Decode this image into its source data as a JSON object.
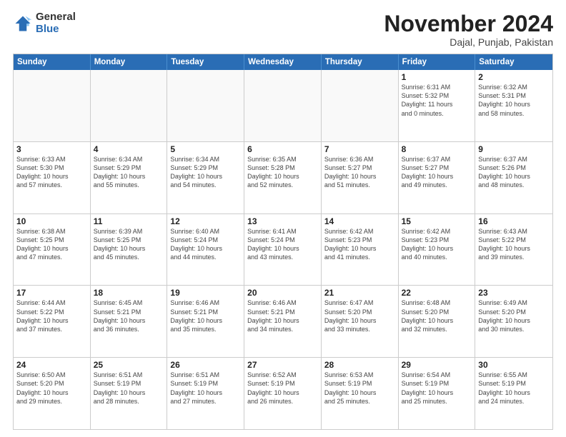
{
  "logo": {
    "general": "General",
    "blue": "Blue"
  },
  "title": "November 2024",
  "subtitle": "Dajal, Punjab, Pakistan",
  "header_days": [
    "Sunday",
    "Monday",
    "Tuesday",
    "Wednesday",
    "Thursday",
    "Friday",
    "Saturday"
  ],
  "weeks": [
    [
      {
        "day": "",
        "info": "",
        "shaded": true
      },
      {
        "day": "",
        "info": "",
        "shaded": true
      },
      {
        "day": "",
        "info": "",
        "shaded": true
      },
      {
        "day": "",
        "info": "",
        "shaded": true
      },
      {
        "day": "",
        "info": "",
        "shaded": true
      },
      {
        "day": "1",
        "info": "Sunrise: 6:31 AM\nSunset: 5:32 PM\nDaylight: 11 hours\nand 0 minutes."
      },
      {
        "day": "2",
        "info": "Sunrise: 6:32 AM\nSunset: 5:31 PM\nDaylight: 10 hours\nand 58 minutes."
      }
    ],
    [
      {
        "day": "3",
        "info": "Sunrise: 6:33 AM\nSunset: 5:30 PM\nDaylight: 10 hours\nand 57 minutes."
      },
      {
        "day": "4",
        "info": "Sunrise: 6:34 AM\nSunset: 5:29 PM\nDaylight: 10 hours\nand 55 minutes."
      },
      {
        "day": "5",
        "info": "Sunrise: 6:34 AM\nSunset: 5:29 PM\nDaylight: 10 hours\nand 54 minutes."
      },
      {
        "day": "6",
        "info": "Sunrise: 6:35 AM\nSunset: 5:28 PM\nDaylight: 10 hours\nand 52 minutes."
      },
      {
        "day": "7",
        "info": "Sunrise: 6:36 AM\nSunset: 5:27 PM\nDaylight: 10 hours\nand 51 minutes."
      },
      {
        "day": "8",
        "info": "Sunrise: 6:37 AM\nSunset: 5:27 PM\nDaylight: 10 hours\nand 49 minutes."
      },
      {
        "day": "9",
        "info": "Sunrise: 6:37 AM\nSunset: 5:26 PM\nDaylight: 10 hours\nand 48 minutes."
      }
    ],
    [
      {
        "day": "10",
        "info": "Sunrise: 6:38 AM\nSunset: 5:25 PM\nDaylight: 10 hours\nand 47 minutes."
      },
      {
        "day": "11",
        "info": "Sunrise: 6:39 AM\nSunset: 5:25 PM\nDaylight: 10 hours\nand 45 minutes."
      },
      {
        "day": "12",
        "info": "Sunrise: 6:40 AM\nSunset: 5:24 PM\nDaylight: 10 hours\nand 44 minutes."
      },
      {
        "day": "13",
        "info": "Sunrise: 6:41 AM\nSunset: 5:24 PM\nDaylight: 10 hours\nand 43 minutes."
      },
      {
        "day": "14",
        "info": "Sunrise: 6:42 AM\nSunset: 5:23 PM\nDaylight: 10 hours\nand 41 minutes."
      },
      {
        "day": "15",
        "info": "Sunrise: 6:42 AM\nSunset: 5:23 PM\nDaylight: 10 hours\nand 40 minutes."
      },
      {
        "day": "16",
        "info": "Sunrise: 6:43 AM\nSunset: 5:22 PM\nDaylight: 10 hours\nand 39 minutes."
      }
    ],
    [
      {
        "day": "17",
        "info": "Sunrise: 6:44 AM\nSunset: 5:22 PM\nDaylight: 10 hours\nand 37 minutes."
      },
      {
        "day": "18",
        "info": "Sunrise: 6:45 AM\nSunset: 5:21 PM\nDaylight: 10 hours\nand 36 minutes."
      },
      {
        "day": "19",
        "info": "Sunrise: 6:46 AM\nSunset: 5:21 PM\nDaylight: 10 hours\nand 35 minutes."
      },
      {
        "day": "20",
        "info": "Sunrise: 6:46 AM\nSunset: 5:21 PM\nDaylight: 10 hours\nand 34 minutes."
      },
      {
        "day": "21",
        "info": "Sunrise: 6:47 AM\nSunset: 5:20 PM\nDaylight: 10 hours\nand 33 minutes."
      },
      {
        "day": "22",
        "info": "Sunrise: 6:48 AM\nSunset: 5:20 PM\nDaylight: 10 hours\nand 32 minutes."
      },
      {
        "day": "23",
        "info": "Sunrise: 6:49 AM\nSunset: 5:20 PM\nDaylight: 10 hours\nand 30 minutes."
      }
    ],
    [
      {
        "day": "24",
        "info": "Sunrise: 6:50 AM\nSunset: 5:20 PM\nDaylight: 10 hours\nand 29 minutes."
      },
      {
        "day": "25",
        "info": "Sunrise: 6:51 AM\nSunset: 5:19 PM\nDaylight: 10 hours\nand 28 minutes."
      },
      {
        "day": "26",
        "info": "Sunrise: 6:51 AM\nSunset: 5:19 PM\nDaylight: 10 hours\nand 27 minutes."
      },
      {
        "day": "27",
        "info": "Sunrise: 6:52 AM\nSunset: 5:19 PM\nDaylight: 10 hours\nand 26 minutes."
      },
      {
        "day": "28",
        "info": "Sunrise: 6:53 AM\nSunset: 5:19 PM\nDaylight: 10 hours\nand 25 minutes."
      },
      {
        "day": "29",
        "info": "Sunrise: 6:54 AM\nSunset: 5:19 PM\nDaylight: 10 hours\nand 25 minutes."
      },
      {
        "day": "30",
        "info": "Sunrise: 6:55 AM\nSunset: 5:19 PM\nDaylight: 10 hours\nand 24 minutes."
      }
    ]
  ]
}
